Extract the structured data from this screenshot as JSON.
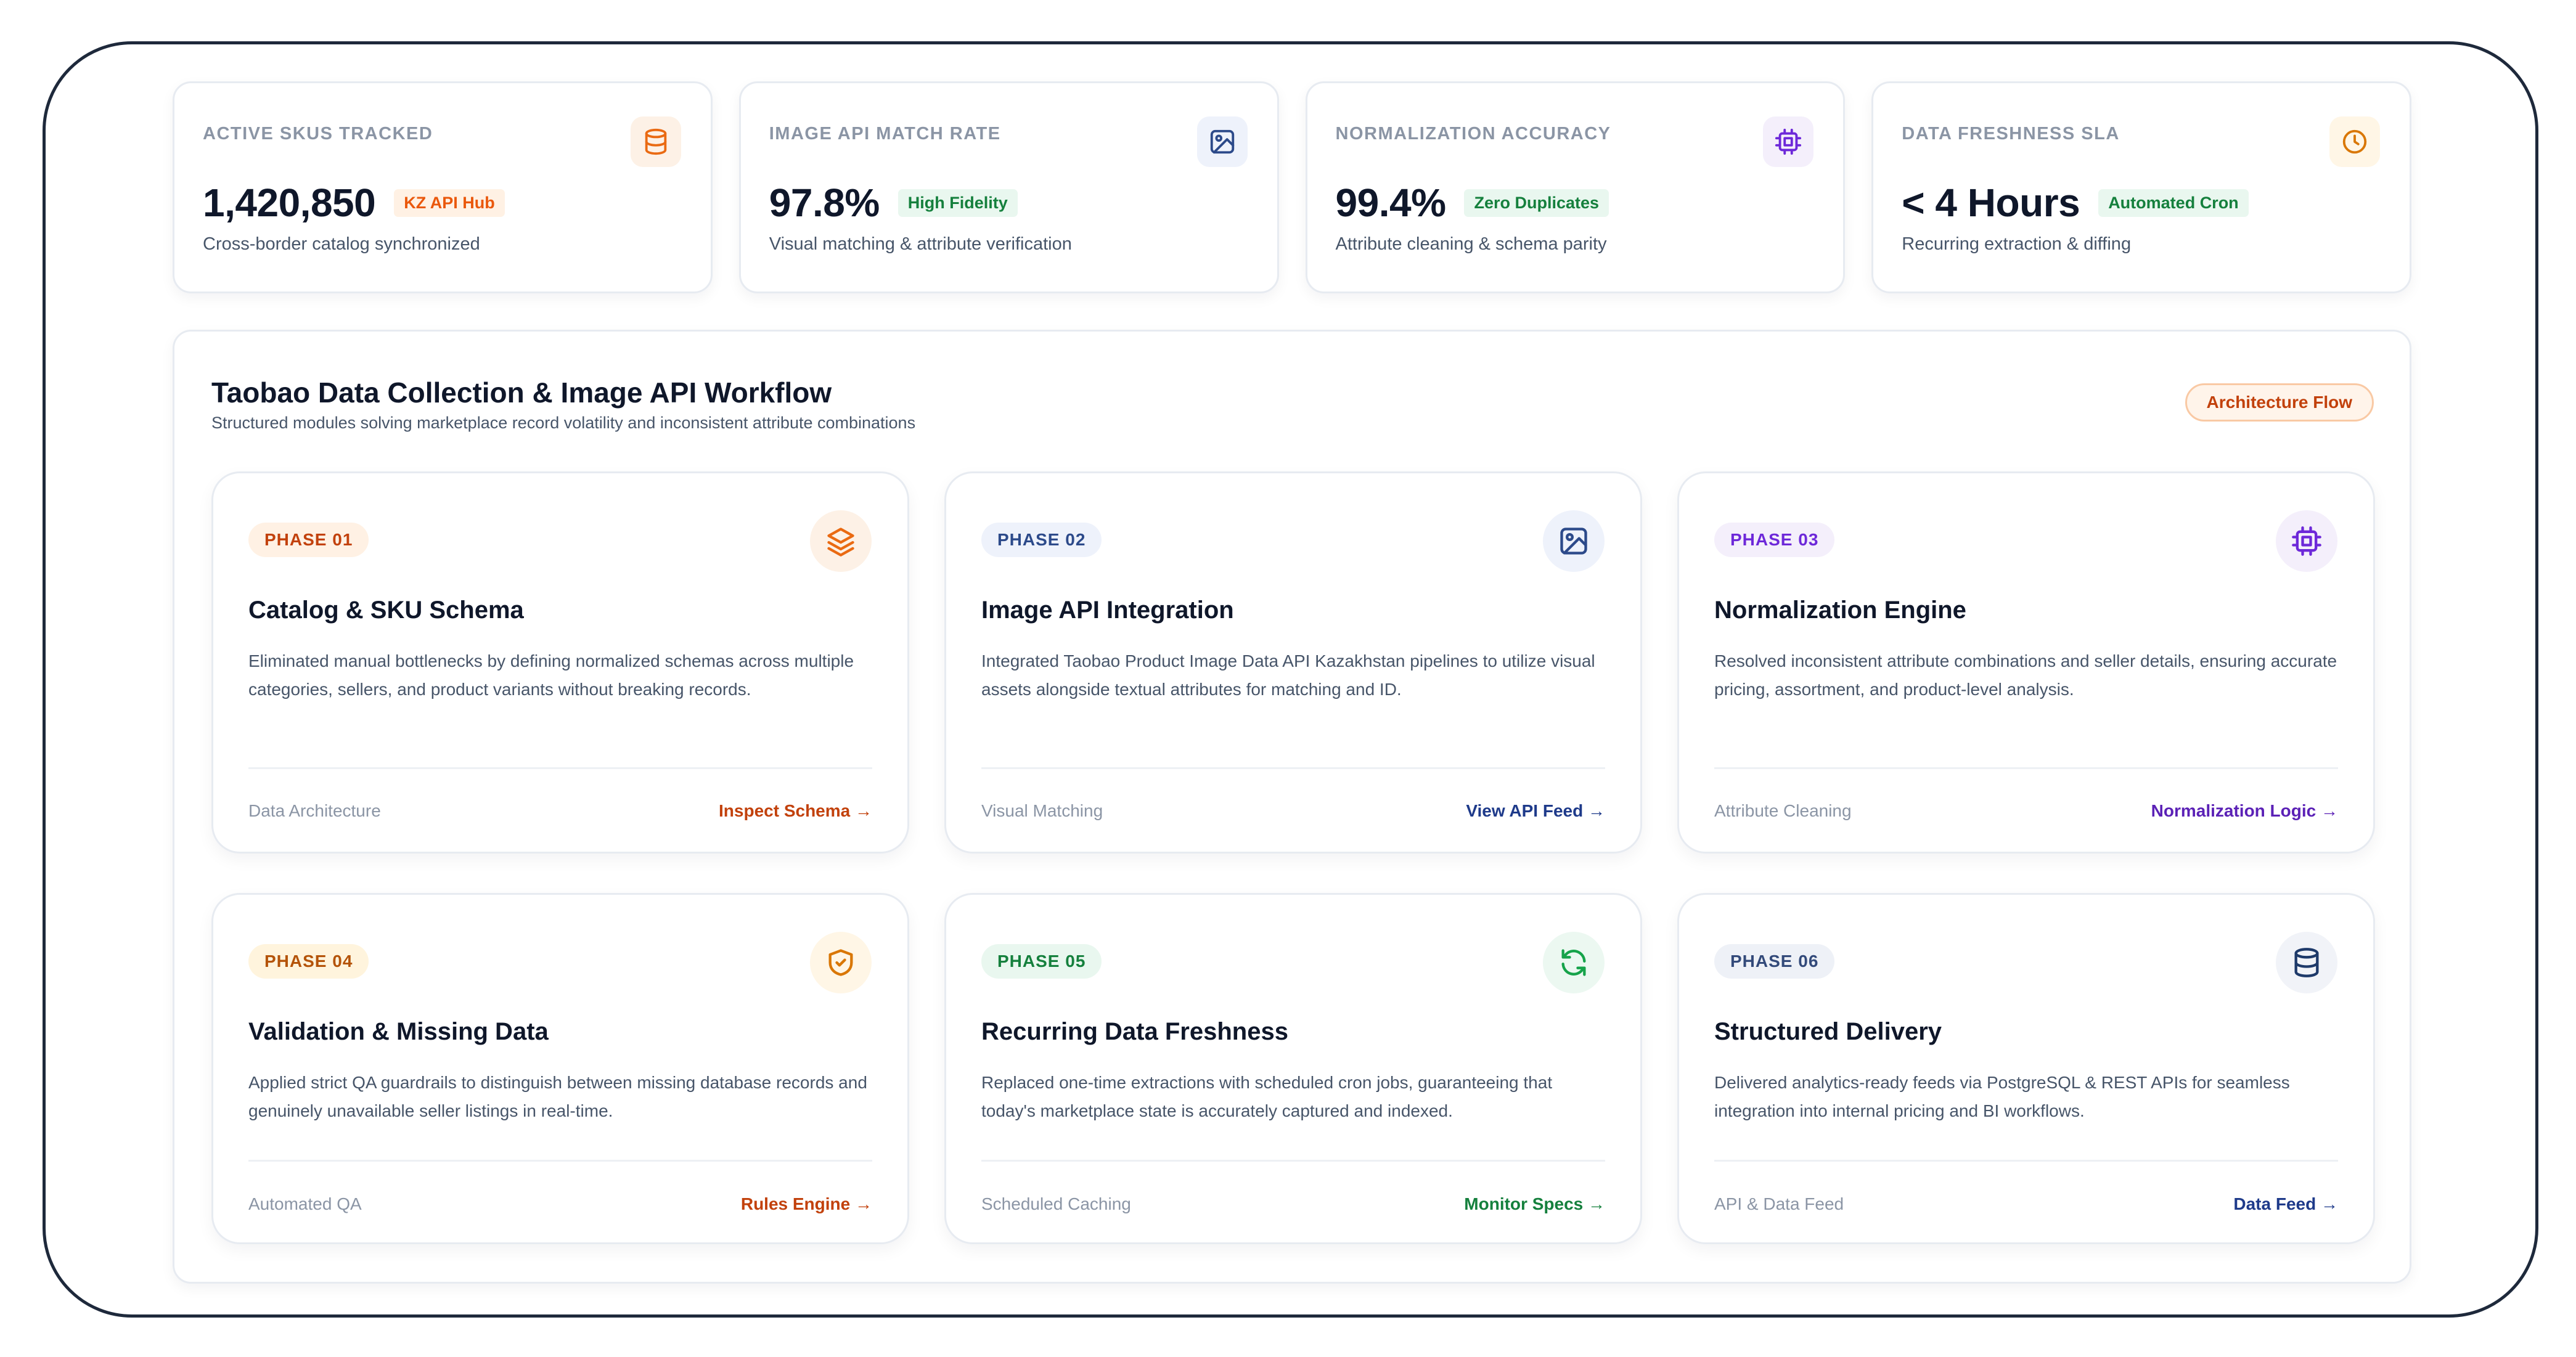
{
  "stats": [
    {
      "label": "ACTIVE SKUS TRACKED",
      "value": "1,420,850",
      "tag": "KZ API Hub",
      "desc": "Cross-border catalog synchronized",
      "icon": "database-icon",
      "accent": "#ea6a12"
    },
    {
      "label": "IMAGE API MATCH RATE",
      "value": "97.8%",
      "tag": "High Fidelity",
      "desc": "Visual matching & attribute verification",
      "icon": "image-icon",
      "accent": "#2c4a8a"
    },
    {
      "label": "NORMALIZATION ACCURACY",
      "value": "99.4%",
      "tag": "Zero Duplicates",
      "desc": "Attribute cleaning & schema parity",
      "icon": "cpu-icon",
      "accent": "#6d28d9"
    },
    {
      "label": "DATA FRESHNESS SLA",
      "value": "< 4 Hours",
      "tag": "Automated Cron",
      "desc": "Recurring extraction & diffing",
      "icon": "clock-icon",
      "accent": "#d97706"
    }
  ],
  "panel": {
    "title": "Taobao Data Collection & Image API Workflow",
    "subtitle": "Structured modules solving marketplace record volatility and inconsistent attribute combinations",
    "badge": "Architecture Flow"
  },
  "phases": [
    {
      "phase": "PHASE 01",
      "title": "Catalog & SKU Schema",
      "desc": "Eliminated manual bottlenecks by defining normalized schemas across multiple categories, sellers, and product variants without breaking records.",
      "category": "Data Architecture",
      "link": "Inspect Schema →",
      "icon": "layers-icon"
    },
    {
      "phase": "PHASE 02",
      "title": "Image API Integration",
      "desc": "Integrated Taobao Product Image Data API Kazakhstan pipelines to utilize visual assets alongside textual attributes for matching and ID.",
      "category": "Visual Matching",
      "link": "View API Feed →",
      "icon": "image-icon"
    },
    {
      "phase": "PHASE 03",
      "title": "Normalization Engine",
      "desc": "Resolved inconsistent attribute combinations and seller details, ensuring accurate pricing, assortment, and product-level analysis.",
      "category": "Attribute Cleaning",
      "link": "Normalization Logic →",
      "icon": "cpu-icon"
    },
    {
      "phase": "PHASE 04",
      "title": "Validation & Missing Data",
      "desc": "Applied strict QA guardrails to distinguish between missing database records and genuinely unavailable seller listings in real-time.",
      "category": "Automated QA",
      "link": "Rules Engine →",
      "icon": "shield-check-icon"
    },
    {
      "phase": "PHASE 05",
      "title": "Recurring Data Freshness",
      "desc": "Replaced one-time extractions with scheduled cron jobs, guaranteeing that today's marketplace state is accurately captured and indexed.",
      "category": "Scheduled Caching",
      "link": "Monitor Specs →",
      "icon": "refresh-icon"
    },
    {
      "phase": "PHASE 06",
      "title": "Structured Delivery",
      "desc": "Delivered analytics-ready feeds via PostgreSQL & REST APIs for seamless integration into internal pricing and BI workflows.",
      "category": "API & Data Feed",
      "link": "Data Feed →",
      "icon": "database-icon"
    }
  ]
}
